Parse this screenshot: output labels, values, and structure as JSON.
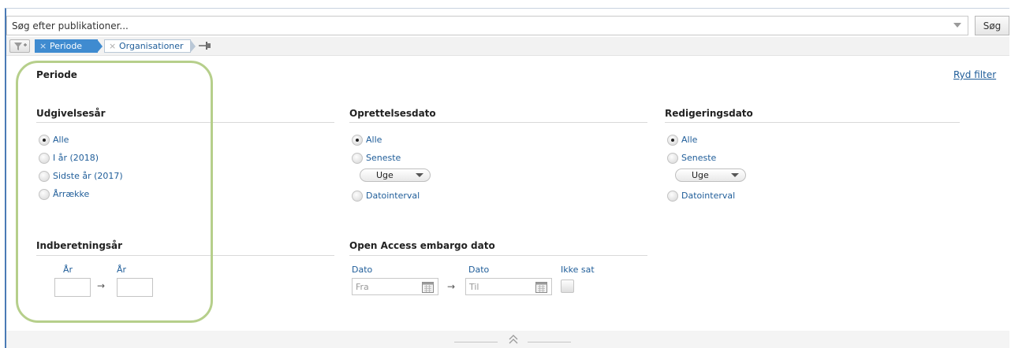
{
  "search": {
    "placeholder": "Søg efter publikationer...",
    "button_label": "Søg"
  },
  "filterbar": {
    "crumbs": [
      {
        "label": "Periode",
        "active": true
      },
      {
        "label": "Organisationer",
        "active": false
      }
    ],
    "remove_symbol": "×"
  },
  "panel": {
    "title": "Periode",
    "clear_label": "Ryd filter"
  },
  "udgivelsesaar": {
    "title": "Udgivelsesår",
    "options": [
      "Alle",
      "I år (2018)",
      "Sidste år (2017)",
      "Årrække"
    ],
    "selected": "Alle"
  },
  "oprettelsesdato": {
    "title": "Oprettelsesdato",
    "options": [
      "Alle",
      "Seneste",
      "Datointerval"
    ],
    "selected": "Alle",
    "period_value": "Uge"
  },
  "redigeringsdato": {
    "title": "Redigeringsdato",
    "options": [
      "Alle",
      "Seneste",
      "Datointerval"
    ],
    "selected": "Alle",
    "period_value": "Uge"
  },
  "indberetningsaar": {
    "title": "Indberetningsår",
    "from_label": "År",
    "to_label": "År",
    "from_value": "",
    "to_value": ""
  },
  "open_access": {
    "title": "Open Access embargo dato",
    "from_label": "Dato",
    "to_label": "Dato",
    "from_placeholder": "Fra",
    "to_placeholder": "Til",
    "not_set_label": "Ikke sat"
  },
  "colors": {
    "accent": "#3f8bd0",
    "link": "#1f5d99",
    "highlight": "#b6cf8b"
  }
}
